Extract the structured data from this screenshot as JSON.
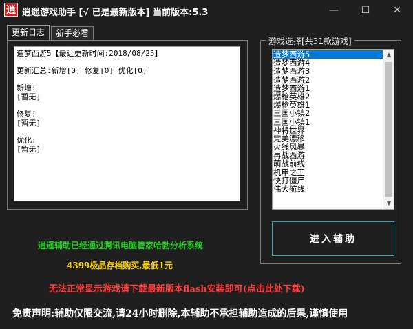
{
  "window": {
    "title": "逍遥游戏助手 [√ 已是最新版本]  当前版本:5.3",
    "app_icon_char": "逍",
    "min_glyph": "—",
    "max_glyph": "☐",
    "close_glyph": "✕"
  },
  "tabs": [
    {
      "label": "更新日志"
    },
    {
      "label": "新手必看"
    }
  ],
  "log": {
    "lines": [
      "造梦西游5【最近更新时间:2018/08/25】",
      "",
      "更新汇总:新增[0] 修复[0] 优化[0]",
      "",
      "新增:",
      "[暂无]",
      "",
      "修复:",
      "[暂无]",
      "",
      "优化:",
      "[暂无]"
    ]
  },
  "game_select": {
    "title": "游戏选择[共31款游戏]",
    "items": [
      "造梦西游5",
      "造梦西游4",
      "造梦西游3",
      "造梦西游2",
      "造梦西游1",
      "爆枪英雄2",
      "爆枪英雄1",
      "三国小镇2",
      "三国小镇1",
      "神将世界",
      "完美漂移",
      "火线风暴",
      "再战西游",
      "萌战前线",
      "机甲之王",
      "快打僵尸",
      "伟大航线"
    ],
    "selected_index": 0
  },
  "enter_button": {
    "label": "进入辅助"
  },
  "notices": {
    "verified": "逍遥辅助已经通过腾讯电脑管家哈勃分析系统",
    "store": "4399极品存档购买,最低1元",
    "flash": "无法正常显示游戏请下载最新版本flash安装即可(点击此处下载)",
    "disclaimer": "免责声明:辅助仅限交流,请24小时删除,本辅助不承担辅助造成的后果,谨慎使用"
  },
  "colors": {
    "background": "#1f1f1f",
    "selection": "#0078d7",
    "button_border": "#2aa8b8",
    "verified_text": "#22cc22",
    "store_text": "#ffd400",
    "flash_text": "#ff3b3b",
    "disclaimer_text": "#ffffff"
  }
}
